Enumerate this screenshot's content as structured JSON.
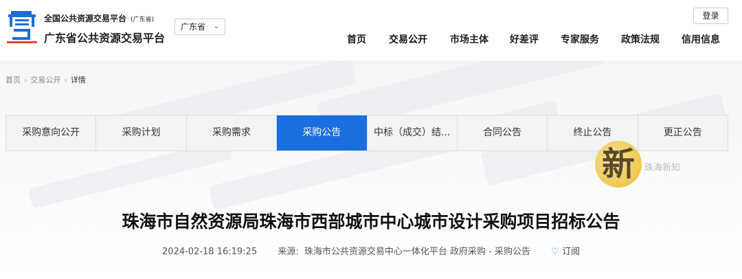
{
  "header": {
    "platform_title": "全国公共资源交易平台",
    "platform_region_note": "(广东省)",
    "site_name": "广东省公共资源交易平台",
    "region_select": "广东省",
    "login_label": "登录",
    "nav": [
      "首页",
      "交易公开",
      "市场主体",
      "好差评",
      "专家服务",
      "政策法规",
      "信用信息"
    ]
  },
  "breadcrumb": [
    "首页",
    "交易公开",
    "详情"
  ],
  "tabs": [
    {
      "label": "采购意向公开",
      "active": false
    },
    {
      "label": "采购计划",
      "active": false
    },
    {
      "label": "采购需求",
      "active": false
    },
    {
      "label": "采购公告",
      "active": true
    },
    {
      "label": "中标（成交）结...",
      "active": false
    },
    {
      "label": "合同公告",
      "active": false
    },
    {
      "label": "终止公告",
      "active": false
    },
    {
      "label": "更正公告",
      "active": false
    }
  ],
  "watermark": {
    "char": "新",
    "text": "珠海新知"
  },
  "article": {
    "title": "珠海市自然资源局珠海市西部城市中心城市设计采购项目招标公告",
    "datetime": "2024-02-18 16:19:25",
    "source_label": "来源:",
    "source": "珠海市公共资源交易中心一体化平台 政府采购 - 采购公告",
    "subscribe_label": "订阅"
  },
  "colors": {
    "accent": "#1a6ee0",
    "logo_blue": "#1d6fd1"
  }
}
